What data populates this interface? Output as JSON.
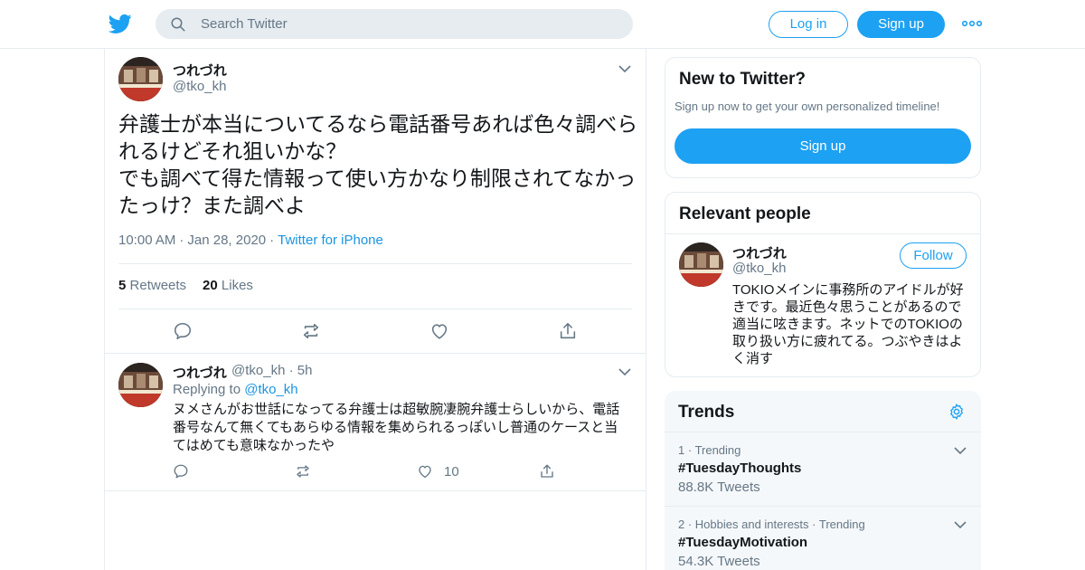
{
  "header": {
    "logo_icon": "twitter-bird-icon",
    "search_placeholder": "Search Twitter",
    "login_label": "Log in",
    "signup_label": "Sign up",
    "more_icon": "more-dots-icon"
  },
  "main_tweet": {
    "name": "つれづれ",
    "handle": "@tko_kh",
    "text": "弁護士が本当についてるなら電話番号あれば色々調べられるけどそれ狙いかな？\nでも調べて得た情報って使い方かなり制限されてなかったっけ？また調べよ",
    "time": "10:00 AM",
    "date": "Jan 28, 2020",
    "source": "Twitter for iPhone",
    "retweets_count": "5",
    "retweets_label": "Retweets",
    "likes_count": "20",
    "likes_label": "Likes"
  },
  "reply_tweet": {
    "name": "つれづれ",
    "handle": "@tko_kh",
    "age": "5h",
    "replying_label": "Replying to",
    "replying_handle": "@tko_kh",
    "text": "ヌメさんがお世話になってる弁護士は超敏腕凄腕弁護士らしいから、電話番号なんて無くてもあらゆる情報を集められるっぽいし普通のケースと当てはめても意味なかったや",
    "likes_count": "10"
  },
  "new_to_twitter": {
    "title": "New to Twitter?",
    "subtitle": "Sign up now to get your own personalized timeline!",
    "signup_label": "Sign up"
  },
  "relevant_people": {
    "title": "Relevant people",
    "name": "つれづれ",
    "handle": "@tko_kh",
    "follow_label": "Follow",
    "bio": "TOKIOメインに事務所のアイドルが好きです。最近色々思うことがあるので適当に呟きます。ネットでのTOKIOの取り扱い方に疲れてる。つぶやきはよく消す"
  },
  "trends": {
    "title": "Trends",
    "items": [
      {
        "rank": "1",
        "category": "Trending",
        "tag": "#TuesdayThoughts",
        "count": "88.8K Tweets"
      },
      {
        "rank": "2",
        "category": "Hobbies and interests · Trending",
        "tag": "#TuesdayMotivation",
        "count": "54.3K Tweets"
      }
    ]
  },
  "colors": {
    "accent": "#1da1f2",
    "link": "#1b95e0",
    "secondary_text": "#657786",
    "border": "#e6ecf0"
  }
}
